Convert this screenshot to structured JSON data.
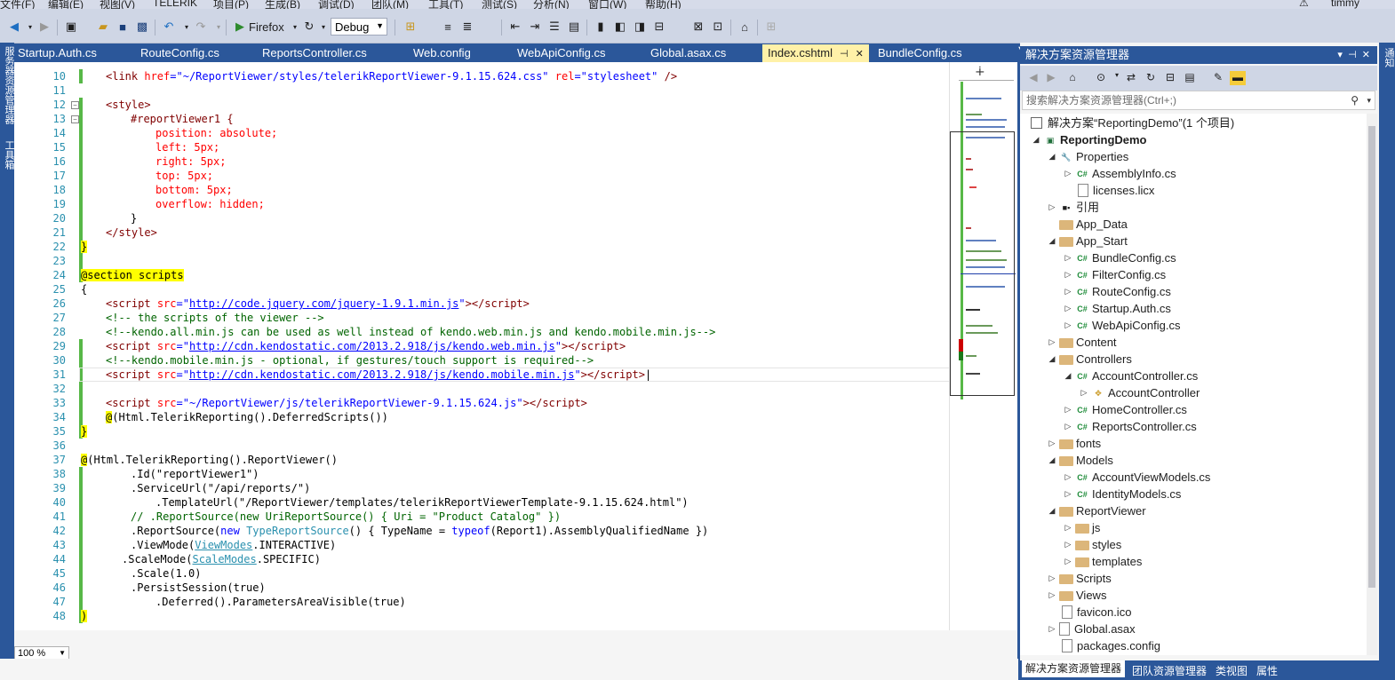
{
  "menu": [
    "文件(F)",
    "编辑(E)",
    "视图(V)",
    "TELERIK",
    "项目(P)",
    "生成(B)",
    "调试(D)",
    "团队(M)",
    "工具(T)",
    "测试(S)",
    "分析(N)",
    "窗口(W)",
    "帮助(H)"
  ],
  "user": "timmy",
  "toolbar": {
    "browser_label": "Firefox",
    "config_label": "Debug"
  },
  "left_rail": [
    "服务器资源管理器",
    "工具箱"
  ],
  "right_rail": "通知",
  "tabs": [
    "Startup.Auth.cs",
    "RouteConfig.cs",
    "ReportsController.cs",
    "Web.config",
    "WebApiConfig.cs",
    "Global.asax.cs",
    "Index.cshtml",
    "BundleConfig.cs"
  ],
  "active_tab": "Index.cshtml",
  "line_numbers": [
    "10",
    "11",
    "12",
    "13",
    "14",
    "15",
    "16",
    "17",
    "18",
    "19",
    "20",
    "21",
    "22",
    "23",
    "24",
    "25",
    "26",
    "27",
    "28",
    "29",
    "30",
    "31",
    "32",
    "33",
    "34",
    "35",
    "36",
    "37",
    "38",
    "39",
    "40",
    "41",
    "42",
    "43",
    "44",
    "45",
    "46",
    "47",
    "48"
  ],
  "code": {
    "l10a": "<link href=\"~/ReportViewer/styles/telerikReportViewer-9.1.15.624.css\" rel=\"stylesheet\" />",
    "l12": "<style>",
    "l13": "#reportViewer1 {",
    "l14": "position: absolute;",
    "l15": "left: 5px;",
    "l16": "right: 5px;",
    "l17": "top: 5px;",
    "l18": "bottom: 5px;",
    "l19": "overflow: hidden;",
    "l20": "}",
    "l21": "</style>",
    "l22": "}",
    "l24": "@section scripts",
    "l25": "{",
    "l26_url": "http://code.jquery.com/jquery-1.9.1.min.js",
    "l27": "<!-- the scripts of the viewer -->",
    "l28": "<!--kendo.all.min.js can be used as well instead of kendo.web.min.js and kendo.mobile.min.js-->",
    "l29_url": "http://cdn.kendostatic.com/2013.2.918/js/kendo.web.min.js",
    "l30": "<!--kendo.mobile.min.js - optional, if gestures/touch support is required-->",
    "l31_url": "http://cdn.kendostatic.com/2013.2.918/js/kendo.mobile.min.js",
    "l33_src": "~/ReportViewer/js/telerikReportViewer-9.1.15.624.js",
    "l34": "(Html.TelerikReporting().DeferredScripts())",
    "l35": "}",
    "l37": "(Html.TelerikReporting().ReportViewer()",
    "l38": ".Id(\"reportViewer1\")",
    "l39": ".ServiceUrl(\"/api/reports/\")",
    "l40": ".TemplateUrl(\"/ReportViewer/templates/telerikReportViewerTemplate-9.1.15.624.html\")",
    "l41": "// .ReportSource(new UriReportSource() { Uri = \"Product Catalog\" })",
    "l42a": ".ReportSource(",
    "l42b": "new",
    "l42c": "TypeReportSource",
    "l42d": "() { TypeName =",
    "l42e": "typeof",
    "l42f": "(Report1).AssemblyQualifiedName })",
    "l43a": ".ViewMode(",
    "l43b": "ViewModes",
    "l43c": ".INTERACTIVE)",
    "l44a": ".ScaleMode(",
    "l44b": "ScaleModes",
    "l44c": ".SPECIFIC)",
    "l45": ".Scale(1.0)",
    "l46": ".PersistSession(true)",
    "l47": ".Deferred().ParametersAreaVisible(true)",
    "l48": ")"
  },
  "zoom": "100 %",
  "solution_explorer": {
    "title": "解决方案资源管理器",
    "search_placeholder": "搜索解决方案资源管理器(Ctrl+;)",
    "items": [
      {
        "label": "解决方案“ReportingDemo”(1 个项目)"
      },
      {
        "label": "ReportingDemo"
      },
      {
        "label": "Properties"
      },
      {
        "label": "AssemblyInfo.cs"
      },
      {
        "label": "licenses.licx"
      },
      {
        "label": "引用"
      },
      {
        "label": "App_Data"
      },
      {
        "label": "App_Start"
      },
      {
        "label": "BundleConfig.cs"
      },
      {
        "label": "FilterConfig.cs"
      },
      {
        "label": "RouteConfig.cs"
      },
      {
        "label": "Startup.Auth.cs"
      },
      {
        "label": "WebApiConfig.cs"
      },
      {
        "label": "Content"
      },
      {
        "label": "Controllers"
      },
      {
        "label": "AccountController.cs"
      },
      {
        "label": "AccountController"
      },
      {
        "label": "HomeController.cs"
      },
      {
        "label": "ReportsController.cs"
      },
      {
        "label": "fonts"
      },
      {
        "label": "Models"
      },
      {
        "label": "AccountViewModels.cs"
      },
      {
        "label": "IdentityModels.cs"
      },
      {
        "label": "ReportViewer"
      },
      {
        "label": "js"
      },
      {
        "label": "styles"
      },
      {
        "label": "templates"
      },
      {
        "label": "Scripts"
      },
      {
        "label": "Views"
      },
      {
        "label": "favicon.ico"
      },
      {
        "label": "Global.asax"
      },
      {
        "label": "packages.config"
      }
    ],
    "bottom_tabs": [
      "解决方案资源管理器",
      "团队资源管理器",
      "类视图",
      "属性"
    ]
  }
}
